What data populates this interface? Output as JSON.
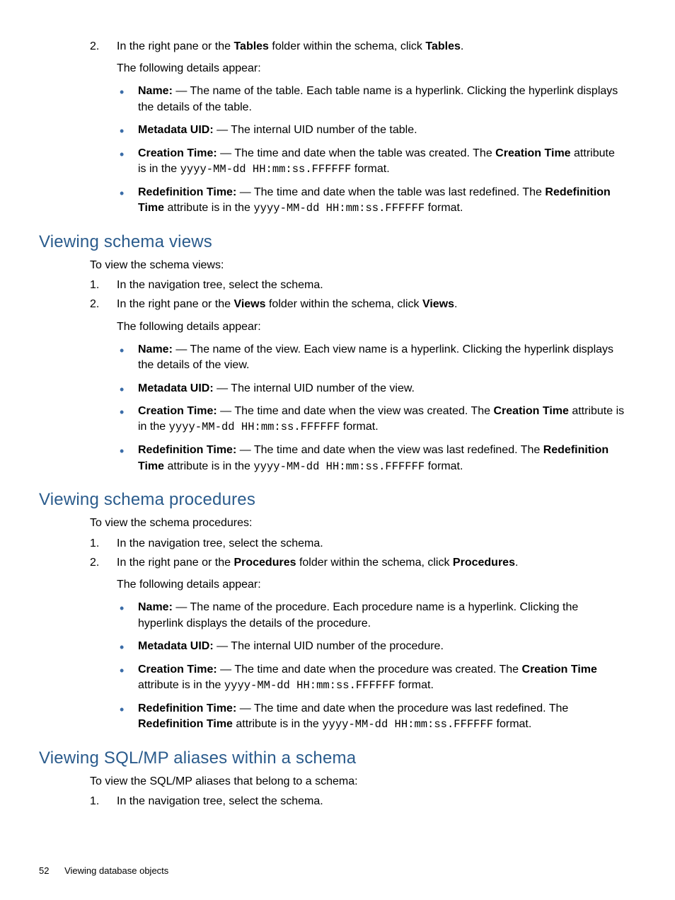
{
  "fmt": "yyyy-MM-dd HH:mm:ss.FFFFFF",
  "fmtSuffix": " format.",
  "topSection": {
    "step2": {
      "num": "2.",
      "prefix": "In the right pane or the ",
      "bold1": "Tables",
      "mid": " folder within the schema, click ",
      "bold2": "Tables",
      "end": "."
    },
    "detailsLead": "The following details appear:",
    "items": {
      "name": {
        "label": "Name:",
        "dash": " — ",
        "text": "The name of the table. Each table name is a hyperlink. Clicking the hyperlink displays the details of the table."
      },
      "uid": {
        "label": "Metadata UID:",
        "dash": " — ",
        "text": "The internal UID number of the table."
      },
      "ctime": {
        "label": "Creation Time:",
        "dash": " — ",
        "pre": "The time and date when the table was created. The ",
        "bold": "Creation Time",
        "post": " attribute is in the "
      },
      "rtime": {
        "label": "Redefinition Time:",
        "dash": " — ",
        "pre": "The time and date when the table was last redefined. The ",
        "bold": "Redefinition Time",
        "post": " attribute is in the "
      }
    }
  },
  "views": {
    "heading": "Viewing schema views",
    "intro": "To view the schema views:",
    "step1": {
      "num": "1.",
      "text": "In the navigation tree, select the schema."
    },
    "step2": {
      "num": "2.",
      "prefix": "In the right pane or the ",
      "bold1": "Views",
      "mid": " folder within the schema, click ",
      "bold2": "Views",
      "end": "."
    },
    "detailsLead": "The following details appear:",
    "items": {
      "name": {
        "label": "Name:",
        "dash": " — ",
        "text": "The name of the view. Each view name is a hyperlink. Clicking the hyperlink displays the details of the view."
      },
      "uid": {
        "label": "Metadata UID:",
        "dash": " — ",
        "text": "The internal UID number of the view."
      },
      "ctime": {
        "label": "Creation Time:",
        "dash": " — ",
        "pre": "The time and date when the view was created. The ",
        "bold": "Creation Time",
        "post": " attribute is in the "
      },
      "rtime": {
        "label": "Redefinition Time:",
        "dash": " — ",
        "pre": "The time and date when the view was last redefined. The ",
        "bold": "Redefinition Time",
        "post": " attribute is in the "
      }
    }
  },
  "procs": {
    "heading": "Viewing schema procedures",
    "intro": "To view the schema procedures:",
    "step1": {
      "num": "1.",
      "text": "In the navigation tree, select the schema."
    },
    "step2": {
      "num": "2.",
      "prefix": "In the right pane or the ",
      "bold1": "Procedures",
      "mid": " folder within the schema, click ",
      "bold2": "Procedures",
      "end": "."
    },
    "detailsLead": "The following details appear:",
    "items": {
      "name": {
        "label": "Name:",
        "dash": " — ",
        "text": "The name of the procedure. Each procedure name is a hyperlink. Clicking the hyperlink displays the details of the procedure."
      },
      "uid": {
        "label": "Metadata UID:",
        "dash": " — ",
        "text": "The internal UID number of the procedure."
      },
      "ctime": {
        "label": "Creation Time:",
        "dash": " — ",
        "pre": "The time and date when the procedure was created. The ",
        "bold": "Creation Time",
        "post": " attribute is in the "
      },
      "rtime": {
        "label": "Redefinition Time:",
        "dash": " — ",
        "pre": "The time and date when the procedure was last redefined. The ",
        "bold": "Redefinition Time",
        "post": " attribute is in the "
      }
    }
  },
  "aliases": {
    "heading": "Viewing SQL/MP aliases within a schema",
    "intro": "To view the SQL/MP aliases that belong to a schema:",
    "step1": {
      "num": "1.",
      "text": "In the navigation tree, select the schema."
    }
  },
  "footer": {
    "page": "52",
    "title": "Viewing database objects"
  }
}
